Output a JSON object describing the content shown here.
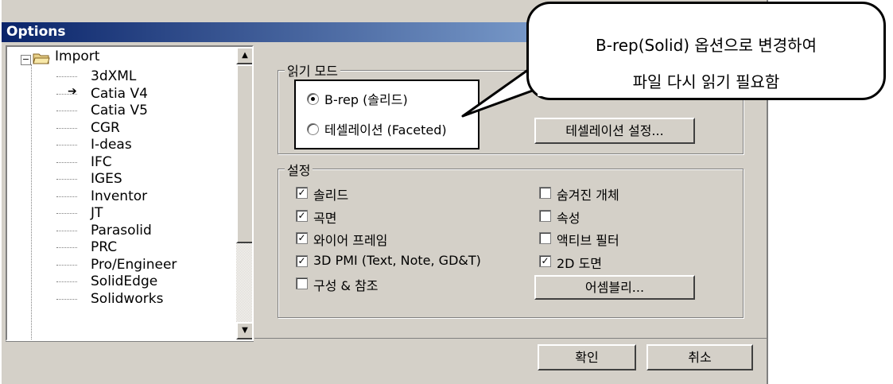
{
  "window": {
    "title": "Options"
  },
  "tree": {
    "root": "Import",
    "items": [
      "3dXML",
      "Catia V4",
      "Catia V5",
      "CGR",
      "I-deas",
      "IFC",
      "IGES",
      "Inventor",
      "JT",
      "Parasolid",
      "PRC",
      "Pro/Engineer",
      "SolidEdge",
      "Solidworks"
    ],
    "selected": "Catia V4"
  },
  "read_mode": {
    "legend": "읽기 모드",
    "options": [
      {
        "label": "B-rep (솔리드)",
        "selected": true
      },
      {
        "label": "테셀레이션 (Faceted)",
        "selected": false
      }
    ],
    "tess_button": "테셀레이션 설정..."
  },
  "settings": {
    "legend": "설정",
    "left": [
      {
        "label": "솔리드",
        "checked": true
      },
      {
        "label": "곡면",
        "checked": true
      },
      {
        "label": "와이어 프레임",
        "checked": true
      },
      {
        "label": "3D PMI (Text, Note, GD&T)",
        "checked": true
      },
      {
        "label": "구성 & 참조",
        "checked": false
      }
    ],
    "right": [
      {
        "label": "숨겨진 개체",
        "checked": false
      },
      {
        "label": "속성",
        "checked": false
      },
      {
        "label": "액티브 필터",
        "checked": false
      },
      {
        "label": "2D 도면",
        "checked": true
      }
    ],
    "assembly_button": "어셈블리..."
  },
  "footer": {
    "ok": "확인",
    "cancel": "취소"
  },
  "callout": {
    "line1": "B-rep(Solid) 옵션으로 변경하여",
    "line2": "파일 다시 읽기 필요함"
  }
}
